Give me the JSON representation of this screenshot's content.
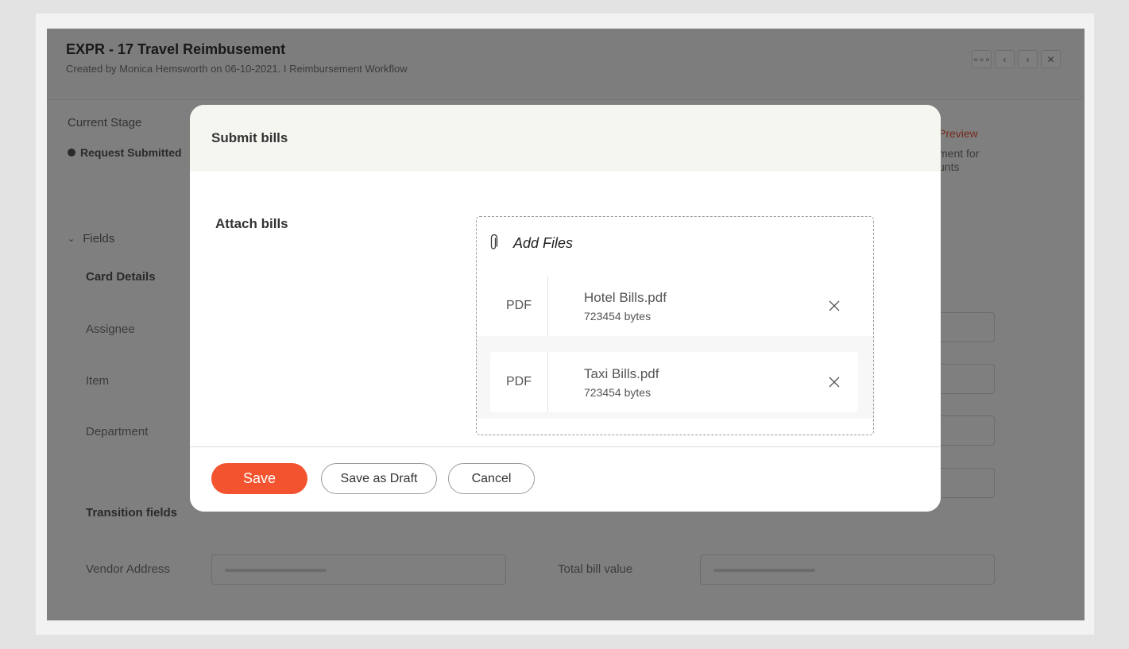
{
  "window": {
    "title": "EXPR - 17 Travel Reimbusement",
    "subtitle": "Created by Monica Hemsworth on 06-10-2021. I  Reimbursement Workflow",
    "header_buttons": [
      "more-icon",
      "prev-icon",
      "next-icon",
      "close-icon"
    ]
  },
  "background": {
    "current_stage_label": "Current Stage",
    "current_stage_value": "Request Submitted",
    "preview_link": "Preview",
    "preview_text": "ment for\nunts",
    "fields_label": "Fields",
    "card_details_title": "Card Details",
    "labels": {
      "assignee": "Assignee",
      "item": "Item",
      "department": "Department"
    },
    "transition_fields_title": "Transition fields",
    "vendor_address_label": "Vendor Address",
    "total_bill_label": "Total bill value"
  },
  "modal": {
    "title": "Submit bills",
    "attach_label": "Attach bills",
    "add_files_label": "Add Files",
    "files": [
      {
        "type": "PDF",
        "name": "Hotel Bills.pdf",
        "size": "723454 bytes"
      },
      {
        "type": "PDF",
        "name": "Taxi Bills.pdf",
        "size": "723454 bytes"
      }
    ],
    "buttons": {
      "save": "Save",
      "save_draft": "Save as Draft",
      "cancel": "Cancel"
    },
    "colors": {
      "primary": "#f4532f",
      "header_bg": "#f6f6f1"
    }
  }
}
